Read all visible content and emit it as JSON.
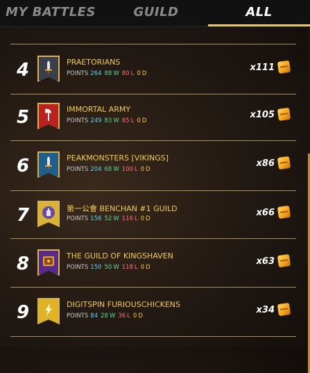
{
  "tabs": [
    {
      "label": "MY BATTLES",
      "active": false
    },
    {
      "label": "GUILD",
      "active": false
    },
    {
      "label": "ALL",
      "active": true
    }
  ],
  "stats_labels": {
    "points": "POINTS",
    "wins": "W",
    "losses": "L",
    "draws": "D"
  },
  "rows": [
    {
      "rank": "4",
      "name": "PRAETORIANS",
      "points": "264",
      "wins": "88",
      "losses": "80",
      "draws": "0",
      "reward": "x111",
      "banner_color": "#3a3f4a",
      "icon": "sword-icon"
    },
    {
      "rank": "5",
      "name": "IMMORTAL ARMY",
      "points": "249",
      "wins": "83",
      "losses": "85",
      "draws": "0",
      "reward": "x105",
      "banner_color": "#b8221f",
      "icon": "axe-icon"
    },
    {
      "rank": "6",
      "name": "PEAKMONSTERS [VIKINGS]",
      "points": "204",
      "wins": "68",
      "losses": "100",
      "draws": "0",
      "reward": "x86",
      "banner_color": "#1f5f8a",
      "icon": "sword-icon"
    },
    {
      "rank": "7",
      "name": "第一公會 BENCHAN #1 GUILD",
      "points": "156",
      "wins": "52",
      "losses": "116",
      "draws": "0",
      "reward": "x66",
      "banner_color": "#d9b23a",
      "icon": "hand-icon"
    },
    {
      "rank": "8",
      "name": "THE GUILD OF KINGSHAVEN",
      "points": "150",
      "wins": "50",
      "losses": "118",
      "draws": "0",
      "reward": "x63",
      "banner_color": "#5a2a8a",
      "icon": "book-icon"
    },
    {
      "rank": "9",
      "name": "DIGITSPIN FURIOUSCHICKENS",
      "points": "84",
      "wins": "28",
      "losses": "36",
      "draws": "0",
      "reward": "x34",
      "banner_color": "#e0b226",
      "icon": "lightning-icon"
    }
  ]
}
